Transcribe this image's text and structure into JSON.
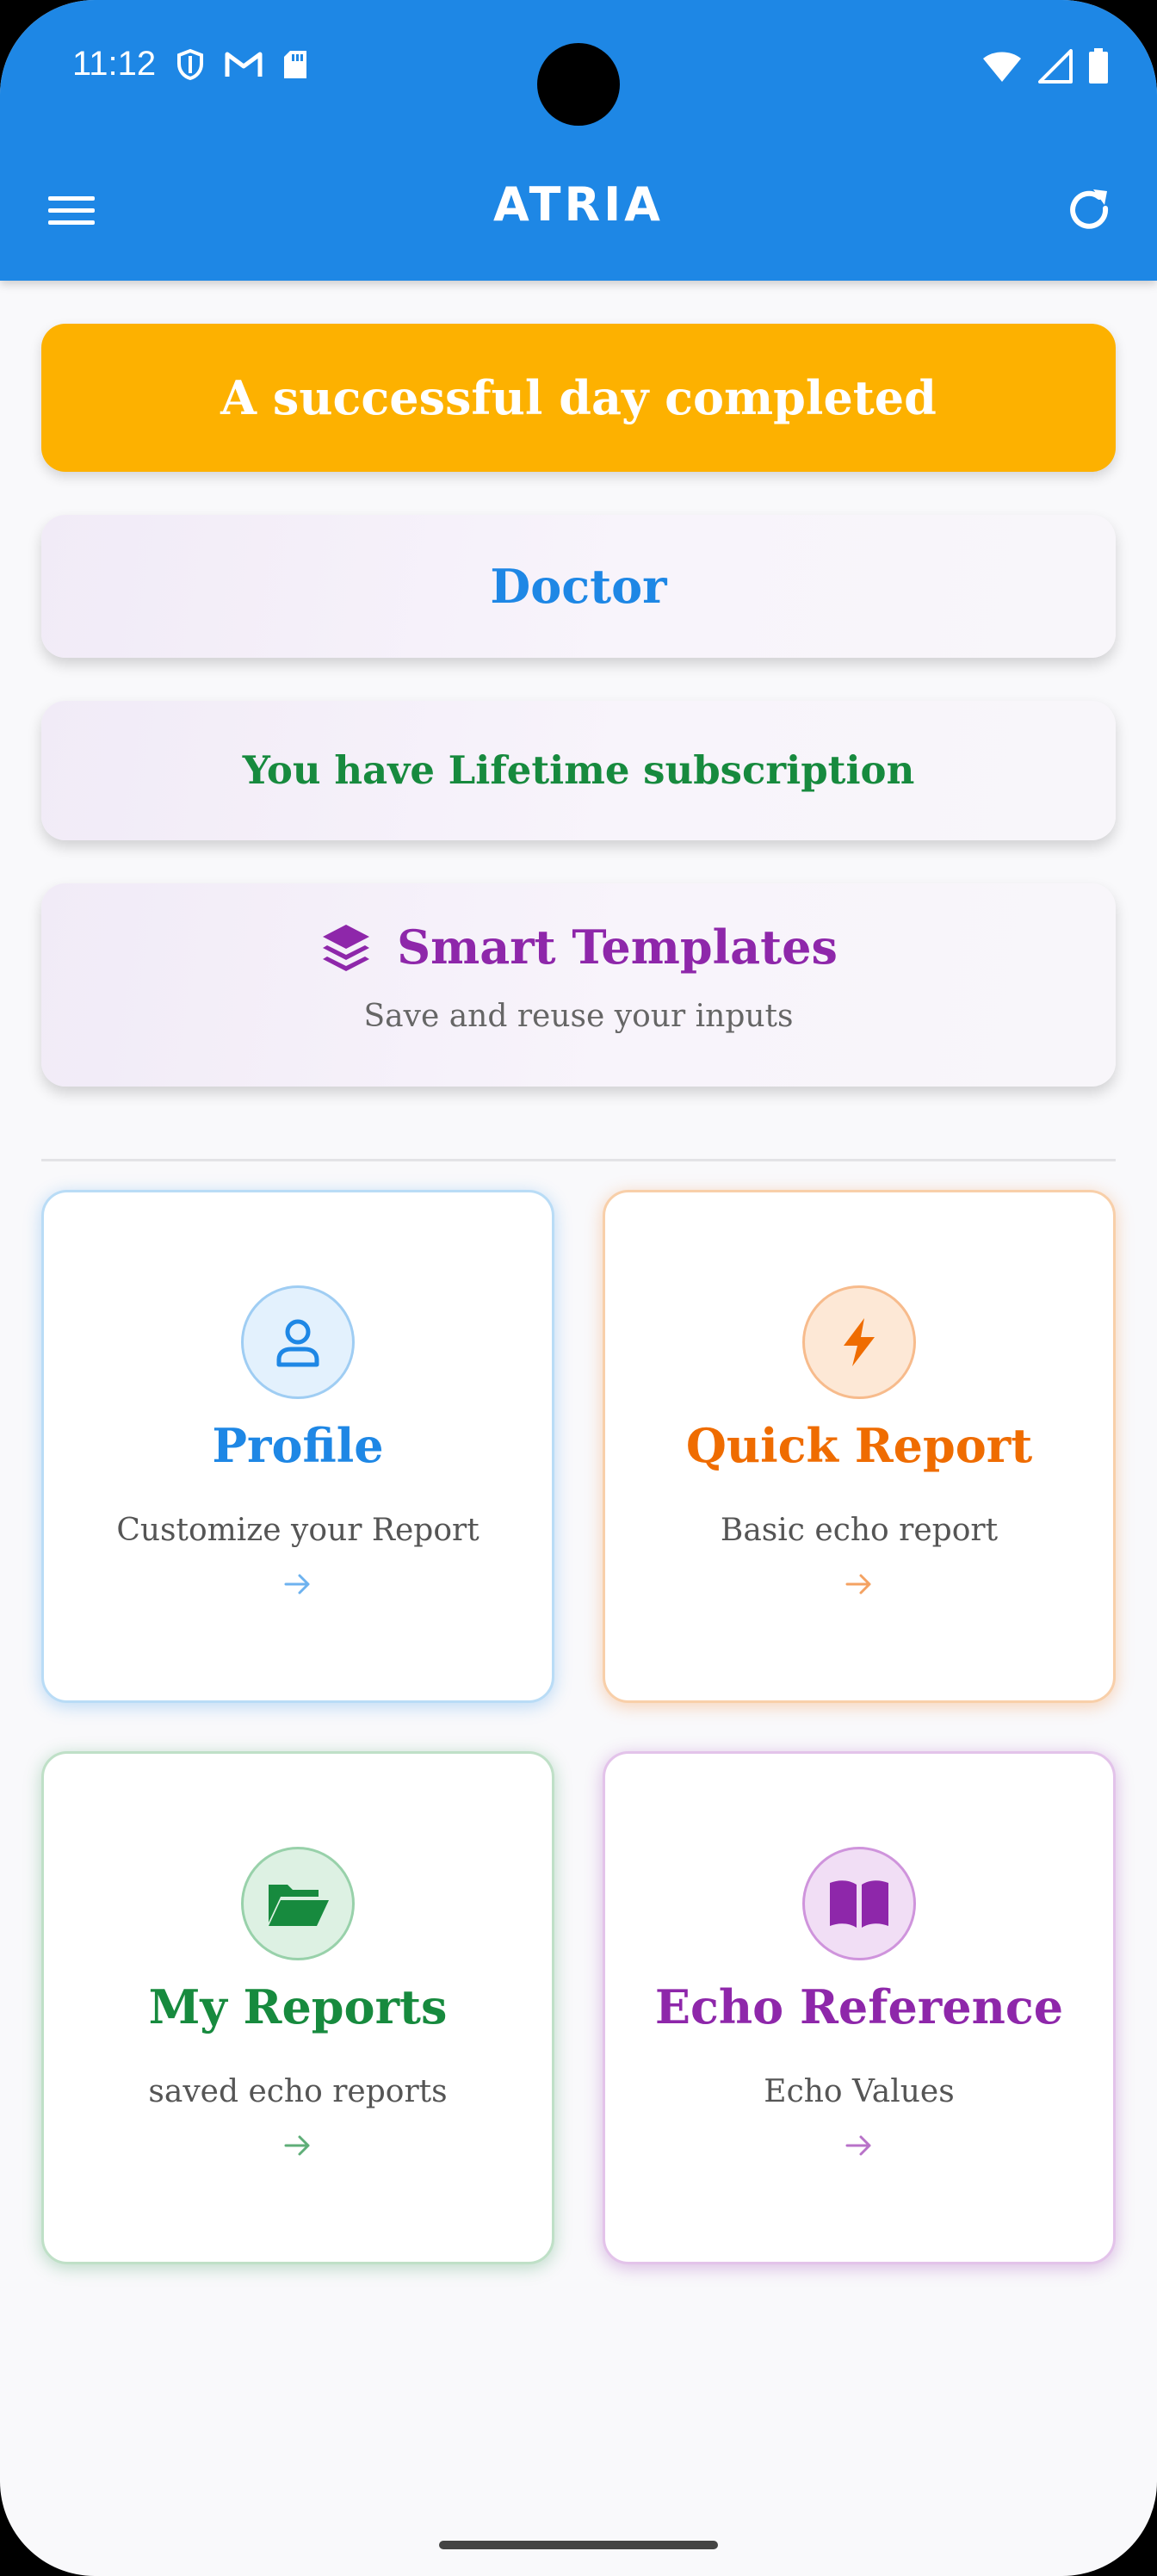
{
  "status_bar": {
    "time": "11:12"
  },
  "app_bar": {
    "title": "ATRIA"
  },
  "banners": {
    "success": "A successful day completed",
    "role": "Doctor",
    "subscription": "You have Lifetime subscription",
    "templates": {
      "title": "Smart Templates",
      "subtitle": "Save and reuse your inputs"
    }
  },
  "features": [
    {
      "title": "Profile",
      "subtitle": "Customize your Report",
      "icon": "person-icon",
      "color": "#1e87e5"
    },
    {
      "title": "Quick Report",
      "subtitle": "Basic echo report",
      "icon": "lightning-icon",
      "color": "#ef6c00"
    },
    {
      "title": "My Reports",
      "subtitle": "saved echo reports",
      "icon": "folder-open-icon",
      "color": "#178a3e"
    },
    {
      "title": "Echo Reference",
      "subtitle": "Echo Values",
      "icon": "book-icon",
      "color": "#8e27aa"
    }
  ],
  "colors": {
    "app_bar": "#1e87e5",
    "success_banner": "#fdb100",
    "subscription_text": "#178a3e",
    "templates_accent": "#8e27aa"
  }
}
